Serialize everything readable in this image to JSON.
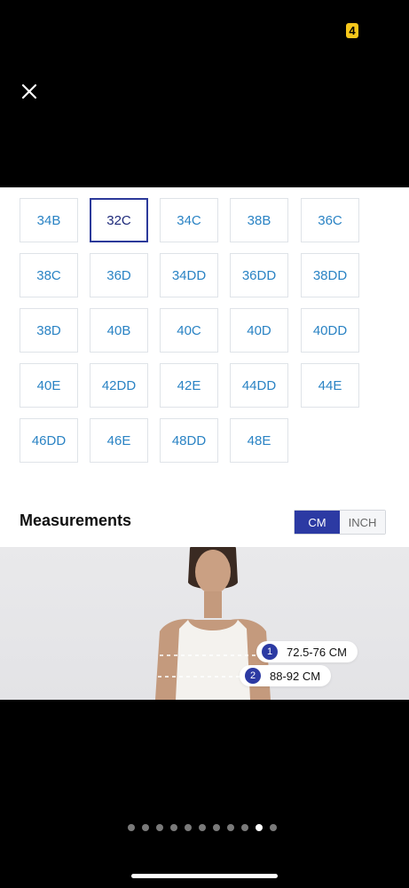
{
  "header": {
    "close_icon": "close-icon",
    "badge_text": "4"
  },
  "sizes": [
    {
      "label": "34B",
      "selected": false
    },
    {
      "label": "32C",
      "selected": true
    },
    {
      "label": "34C",
      "selected": false
    },
    {
      "label": "38B",
      "selected": false
    },
    {
      "label": "36C",
      "selected": false
    },
    {
      "label": "38C",
      "selected": false
    },
    {
      "label": "36D",
      "selected": false
    },
    {
      "label": "34DD",
      "selected": false
    },
    {
      "label": "36DD",
      "selected": false
    },
    {
      "label": "38DD",
      "selected": false
    },
    {
      "label": "38D",
      "selected": false
    },
    {
      "label": "40B",
      "selected": false
    },
    {
      "label": "40C",
      "selected": false
    },
    {
      "label": "40D",
      "selected": false
    },
    {
      "label": "40DD",
      "selected": false
    },
    {
      "label": "40E",
      "selected": false
    },
    {
      "label": "42DD",
      "selected": false
    },
    {
      "label": "42E",
      "selected": false
    },
    {
      "label": "44DD",
      "selected": false
    },
    {
      "label": "44E",
      "selected": false
    },
    {
      "label": "46DD",
      "selected": false
    },
    {
      "label": "46E",
      "selected": false
    },
    {
      "label": "48DD",
      "selected": false
    },
    {
      "label": "48E",
      "selected": false
    }
  ],
  "measurements": {
    "title": "Measurements",
    "unit_cm": "CM",
    "unit_inch": "INCH",
    "active_unit": "CM",
    "points": [
      {
        "number": "1",
        "value": "72.5-76 CM"
      },
      {
        "number": "2",
        "value": "88-92 CM"
      }
    ]
  },
  "pager": {
    "total": 11,
    "active_index": 9
  },
  "colors": {
    "accent": "#2c3aa3",
    "size_text": "#2a83c4",
    "badge": "#f6c71b"
  }
}
